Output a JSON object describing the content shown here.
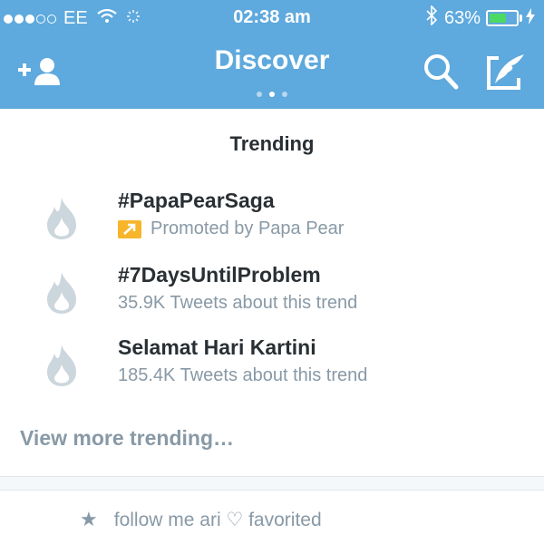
{
  "status_bar": {
    "carrier": "EE",
    "time": "02:38 am",
    "battery_pct": "63%",
    "battery_level": 0.63,
    "signal_bars_filled": 3,
    "signal_bars_total": 5
  },
  "nav": {
    "title": "Discover",
    "page_count": 3,
    "active_page": 2,
    "icons": [
      "add-user-icon",
      "search-icon",
      "compose-icon"
    ]
  },
  "trending": {
    "title": "Trending",
    "items": [
      {
        "name": "#PapaPearSaga",
        "subtitle": "Promoted by Papa Pear",
        "promoted": true
      },
      {
        "name": "#7DaysUntilProblem",
        "subtitle": "35.9K Tweets about this trend",
        "promoted": false
      },
      {
        "name": "Selamat Hari Kartini",
        "subtitle": "185.4K Tweets about this trend",
        "promoted": false
      }
    ],
    "view_more": "View more trending…"
  },
  "activity": {
    "text": "follow me ari ♡ favorited"
  },
  "colors": {
    "header": "#5ea9dd",
    "text_dark": "#292f33",
    "text_muted": "#8899a6",
    "promoted_badge": "#f7b52b",
    "battery": "#4cd964"
  }
}
